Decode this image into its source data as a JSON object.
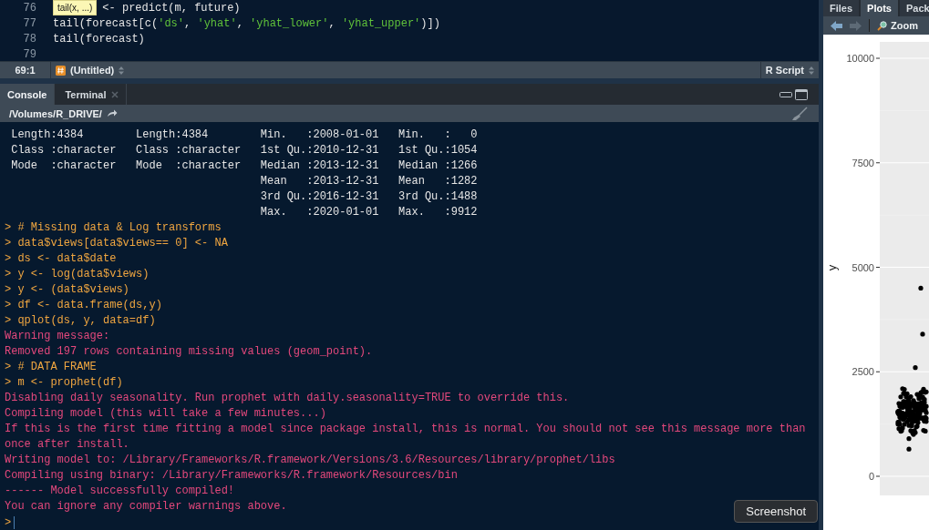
{
  "editor": {
    "lines": [
      {
        "number": "76",
        "tooltip": "tail(x, ...)",
        "segments": [
          {
            "kind": "plain",
            "text": "<- predict(m, future)"
          }
        ]
      },
      {
        "number": "77",
        "segments": [
          {
            "kind": "plain",
            "text": "tail(forecast[c("
          },
          {
            "kind": "string",
            "text": "'ds'"
          },
          {
            "kind": "plain",
            "text": ", "
          },
          {
            "kind": "string",
            "text": "'yhat'"
          },
          {
            "kind": "plain",
            "text": ", "
          },
          {
            "kind": "string",
            "text": "'yhat_lower'"
          },
          {
            "kind": "plain",
            "text": ", "
          },
          {
            "kind": "string",
            "text": "'yhat_upper'"
          },
          {
            "kind": "plain",
            "text": ")])"
          }
        ]
      },
      {
        "number": "78",
        "segments": [
          {
            "kind": "plain",
            "text": "tail(forecast)"
          }
        ]
      },
      {
        "number": "79"
      }
    ]
  },
  "status_bar": {
    "position": "69:1",
    "file": "(Untitled)",
    "file_type": "R Script"
  },
  "console": {
    "tabs": [
      {
        "label": "Console",
        "selected": true,
        "closable": false
      },
      {
        "label": "Terminal",
        "selected": false,
        "closable": true
      }
    ],
    "path": "/Volumes/R_DRIVE/",
    "lines": [
      {
        "kind": "output",
        "text": " Length:4384        Length:4384        Min.   :2008-01-01   Min.   :   0  "
      },
      {
        "kind": "output",
        "text": " Class :character   Class :character   1st Qu.:2010-12-31   1st Qu.:1054  "
      },
      {
        "kind": "output",
        "text": " Mode  :character   Mode  :character   Median :2013-12-31   Median :1266  "
      },
      {
        "kind": "output",
        "text": "                                       Mean   :2013-12-31   Mean   :1282  "
      },
      {
        "kind": "output",
        "text": "                                       3rd Qu.:2016-12-31   3rd Qu.:1488  "
      },
      {
        "kind": "output",
        "text": "                                       Max.   :2020-01-01   Max.   :9912  "
      },
      {
        "kind": "input",
        "text": "> # Missing data & Log transforms"
      },
      {
        "kind": "input",
        "text": "> data$views[data$views== 0] <- NA"
      },
      {
        "kind": "input",
        "text": "> ds <- data$date"
      },
      {
        "kind": "input",
        "text": "> y <- log(data$views)"
      },
      {
        "kind": "input",
        "text": "> y <- (data$views)"
      },
      {
        "kind": "input",
        "text": "> df <- data.frame(ds,y)"
      },
      {
        "kind": "input",
        "text": "> qplot(ds, y, data=df)"
      },
      {
        "kind": "message",
        "text": "Warning message:"
      },
      {
        "kind": "message",
        "text": "Removed 197 rows containing missing values (geom_point)."
      },
      {
        "kind": "input",
        "text": "> # DATA FRAME"
      },
      {
        "kind": "input",
        "text": "> m <- prophet(df)"
      },
      {
        "kind": "message",
        "text": "Disabling daily seasonality. Run prophet with daily.seasonality=TRUE to override this."
      },
      {
        "kind": "message",
        "text": "Compiling model (this will take a few minutes...)"
      },
      {
        "kind": "message",
        "text": "If this is the first time fitting a model since package install, this is normal. You should not see this message more than"
      },
      {
        "kind": "message",
        "text": "once after install."
      },
      {
        "kind": "message",
        "text": "Writing model to: /Library/Frameworks/R.framework/Versions/3.6/Resources/library/prophet/libs"
      },
      {
        "kind": "message",
        "text": "Compiling using binary: /Library/Frameworks/R.framework/Resources/bin"
      },
      {
        "kind": "message",
        "text": "------ Model successfully compiled!"
      },
      {
        "kind": "message",
        "text": "You can ignore any compiler warnings above."
      }
    ],
    "prompt": ">"
  },
  "tooltip": {
    "text": "Screenshot"
  },
  "right_pane": {
    "tabs": [
      {
        "label": "Files",
        "selected": false
      },
      {
        "label": "Plots",
        "selected": true
      },
      {
        "label": "Pack",
        "selected": false
      }
    ],
    "toolbar": {
      "zoom_label": "Zoom"
    },
    "plot": {
      "ylabel": "y",
      "yticks": [
        "10000",
        "7500",
        "5000",
        "2500",
        "0"
      ]
    }
  }
}
